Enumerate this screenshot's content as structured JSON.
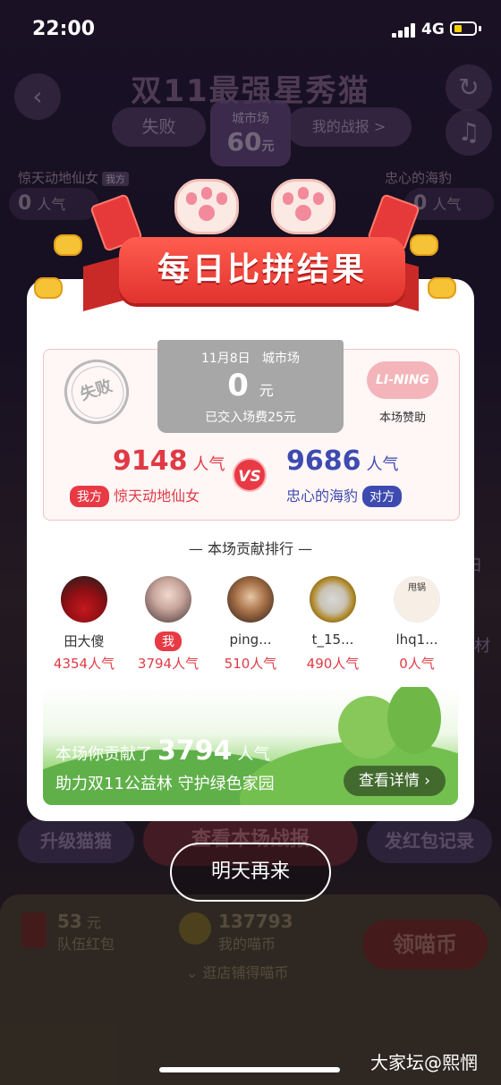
{
  "status_bar": {
    "time": "22:00",
    "network": "4G"
  },
  "background": {
    "title": "双11最强星秀猫",
    "result_pill": "失败",
    "market_label": "城市场",
    "market_amount": "60",
    "market_unit": "元",
    "battle_report": "我的战报 >",
    "left_team": "惊天动地仙女",
    "left_tag": "我方",
    "right_team": "忠心的海豹",
    "left_score": "0",
    "right_score": "0",
    "popularity_unit": "人气",
    "upgrade_cat": "升级猫猫",
    "view_battle": "查看本场战报",
    "send_envelope": "发红包记录",
    "team_envelope_amount": "53",
    "team_envelope_unit": "元",
    "team_envelope_label": "队伍红包",
    "my_coins": "137793",
    "my_coins_label": "我的喵币",
    "claim_coins": "领喵币",
    "shop_tip": "逛店铺得喵币",
    "side_text_1": "扫",
    "side_text_2": "材"
  },
  "dialog": {
    "title": "每日比拼结果",
    "fail_stamp": "失败",
    "date": "11月8日",
    "market": "城市场",
    "amount": "0",
    "amount_unit": "元",
    "fee_text": "已交入场费25元",
    "sponsor_logo": "LI-NING",
    "sponsor_label": "本场赞助",
    "my_score": "9148",
    "opp_score": "9686",
    "popularity_unit": "人气",
    "vs": "VS",
    "my_tag": "我方",
    "my_team": "惊天动地仙女",
    "opp_team": "忠心的海豹",
    "opp_tag": "对方",
    "rank_title": "— 本场贡献排行 —",
    "contributors": [
      {
        "name": "田大傻",
        "popularity": "4354人气",
        "is_me": false
      },
      {
        "name": "我",
        "popularity": "3794人气",
        "is_me": true
      },
      {
        "name": "ping...",
        "popularity": "510人气",
        "is_me": false
      },
      {
        "name": "t_15...",
        "popularity": "490人气",
        "is_me": false
      },
      {
        "name": "lhq1...",
        "popularity": "0人气",
        "is_me": false
      }
    ],
    "avatar_text_5": "甩锅",
    "promo_prefix": "本场你贡献了",
    "promo_value": "3794",
    "promo_suffix": "人气",
    "promo_line2": "助力双11公益林 守护绿色家园",
    "detail_button": "查看详情 ›",
    "again_button": "明天再来"
  },
  "watermark": "大家坛@熙惘",
  "colors": {
    "accent_red": "#e73a45",
    "opp_blue": "#3d4bb0",
    "ribbon_red": "#e1332e"
  }
}
